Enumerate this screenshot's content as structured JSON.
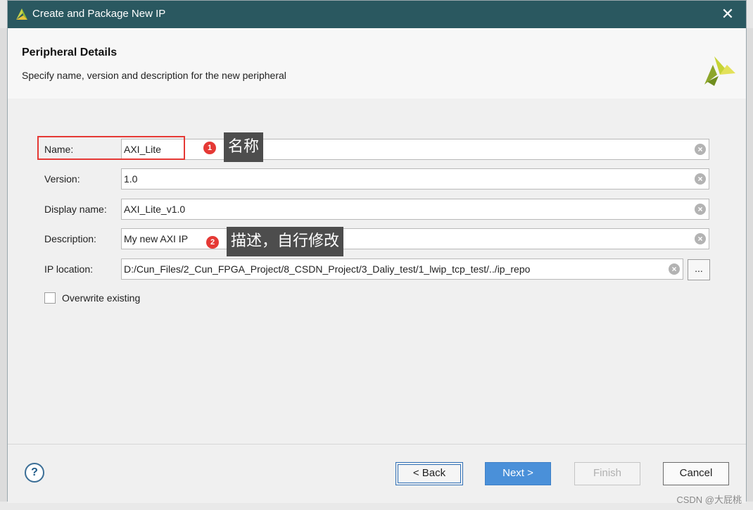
{
  "window": {
    "title": "Create and Package New IP",
    "close_icon": "close-icon"
  },
  "header": {
    "heading": "Peripheral Details",
    "subtitle": "Specify name, version and description for the new peripheral",
    "logo": "vivado-logo-icon"
  },
  "form": {
    "name": {
      "label": "Name:",
      "value": "AXI_Lite"
    },
    "version": {
      "label": "Version:",
      "value": "1.0"
    },
    "display_name": {
      "label": "Display name:",
      "value": "AXI_Lite_v1.0"
    },
    "description": {
      "label": "Description:",
      "value": "My new AXI IP"
    },
    "ip_location": {
      "label": "IP location:",
      "value": "D:/Cun_Files/2_Cun_FPGA_Project/8_CSDN_Project/3_Daliy_test/1_lwip_tcp_test/../ip_repo",
      "browse_label": "..."
    },
    "overwrite": {
      "label": "Overwrite existing",
      "checked": false
    }
  },
  "annotations": [
    {
      "number": "1",
      "text": "名称"
    },
    {
      "number": "2",
      "text": "描述，自行修改"
    }
  ],
  "buttons": {
    "help": "?",
    "back": "< Back",
    "next": "Next >",
    "finish": "Finish",
    "cancel": "Cancel"
  },
  "watermark": "CSDN @大屁桃",
  "colors": {
    "titlebar": "#2a5860",
    "accent_next": "#4a90d9",
    "annotation_highlight": "#e53935"
  }
}
